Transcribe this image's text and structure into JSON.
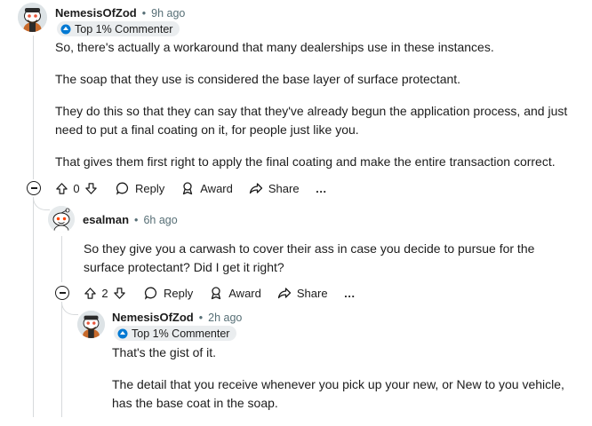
{
  "comments": [
    {
      "username": "NemesisOfZod",
      "time": "9h ago",
      "flair": "Top 1% Commenter",
      "paragraphs": [
        "So, there's actually a workaround that many dealerships use in these instances.",
        "The soap that they use is considered the base layer of surface protectant.",
        "They do this so that they can say that they've already begun the application process, and just need to put a final coating on it, for people just like you.",
        "That gives them first right to apply the final coating and make the entire transaction correct."
      ],
      "score": "0",
      "reply_label": "Reply",
      "award_label": "Award",
      "share_label": "Share",
      "more_label": "…"
    },
    {
      "username": "esalman",
      "time": "6h ago",
      "paragraphs": [
        "So they give you a carwash to cover their ass in case you decide to pursue for the surface protectant? Did I get it right?"
      ],
      "score": "2",
      "reply_label": "Reply",
      "award_label": "Award",
      "share_label": "Share",
      "more_label": "…"
    },
    {
      "username": "NemesisOfZod",
      "time": "2h ago",
      "flair": "Top 1% Commenter",
      "paragraphs": [
        "That's the gist of it.",
        "The detail that you receive whenever you pick up your new, or New to you vehicle, has the base coat in the soap."
      ]
    }
  ],
  "separator": "•",
  "colors": {
    "text": "#1c1c1c",
    "meta": "#576f76",
    "line": "#d7dadc",
    "badge_bg": "#eaedef"
  }
}
